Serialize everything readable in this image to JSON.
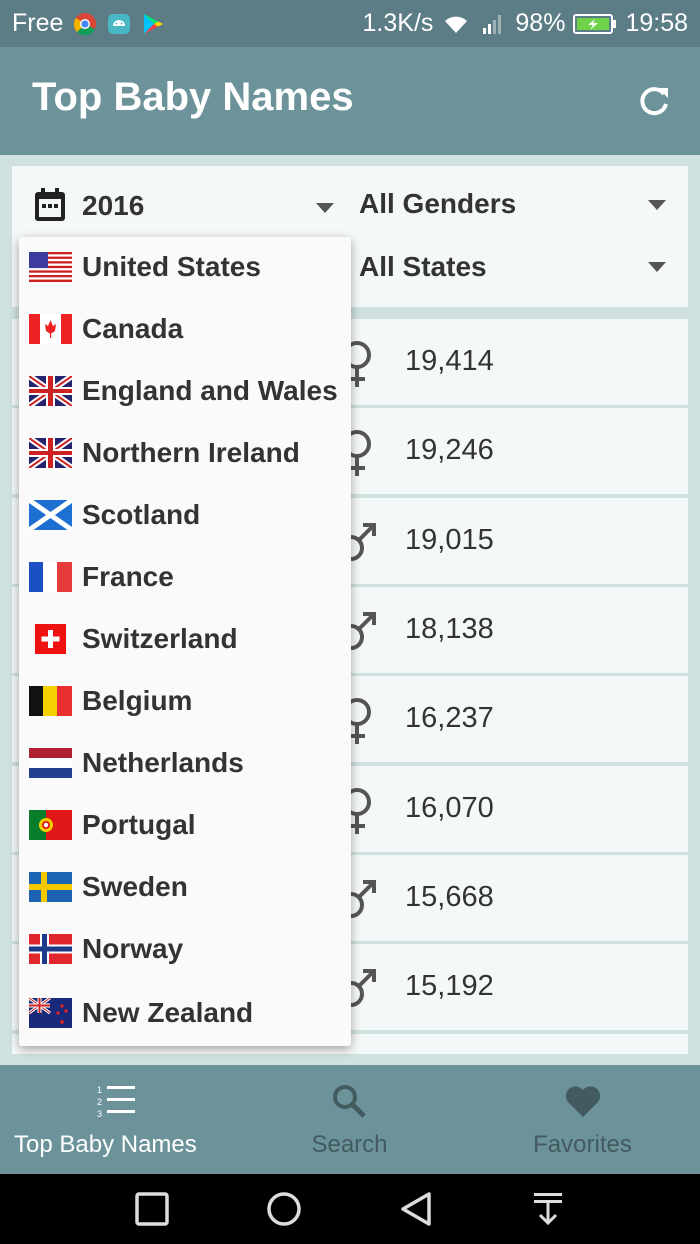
{
  "status_bar": {
    "carrier": "Free",
    "speed": "1.3K/s",
    "battery": "98%",
    "time": "19:58",
    "icons": [
      "chrome-icon",
      "android-icon",
      "play-store-icon",
      "wifi-icon",
      "signal-icon",
      "battery-icon"
    ]
  },
  "app_bar": {
    "title": "Top Baby Names",
    "refresh_icon": "refresh-icon"
  },
  "filters": {
    "year": "2016",
    "gender": "All Genders",
    "state": "All States"
  },
  "rows": [
    {
      "gender": "female",
      "count": "19,414"
    },
    {
      "gender": "female",
      "count": "19,246"
    },
    {
      "gender": "male",
      "count": "19,015"
    },
    {
      "gender": "male",
      "count": "18,138"
    },
    {
      "gender": "female",
      "count": "16,237"
    },
    {
      "gender": "female",
      "count": "16,070"
    },
    {
      "gender": "male",
      "count": "15,668"
    },
    {
      "gender": "male",
      "count": "15,192"
    }
  ],
  "country_menu": [
    {
      "label": "United States",
      "flag": "us-flag"
    },
    {
      "label": "Canada",
      "flag": "canada-flag"
    },
    {
      "label": "England and Wales",
      "flag": "uk-flag"
    },
    {
      "label": "Northern Ireland",
      "flag": "uk-flag"
    },
    {
      "label": "Scotland",
      "flag": "scotland-flag"
    },
    {
      "label": "France",
      "flag": "france-flag"
    },
    {
      "label": "Switzerland",
      "flag": "switzerland-flag"
    },
    {
      "label": "Belgium",
      "flag": "belgium-flag"
    },
    {
      "label": "Netherlands",
      "flag": "netherlands-flag"
    },
    {
      "label": "Portugal",
      "flag": "portugal-flag"
    },
    {
      "label": "Sweden",
      "flag": "sweden-flag"
    },
    {
      "label": "Norway",
      "flag": "norway-flag"
    },
    {
      "label": "New Zealand",
      "flag": "new-zealand-flag"
    }
  ],
  "bottom_nav": {
    "top_names_label": "Top Baby Names",
    "search_label": "Search",
    "favorites_label": "Favorites"
  },
  "colors": {
    "status_bar": "#5c7d85",
    "app_bar": "#6c939a",
    "background": "#cfe2e0",
    "card": "#f5f8f8"
  }
}
